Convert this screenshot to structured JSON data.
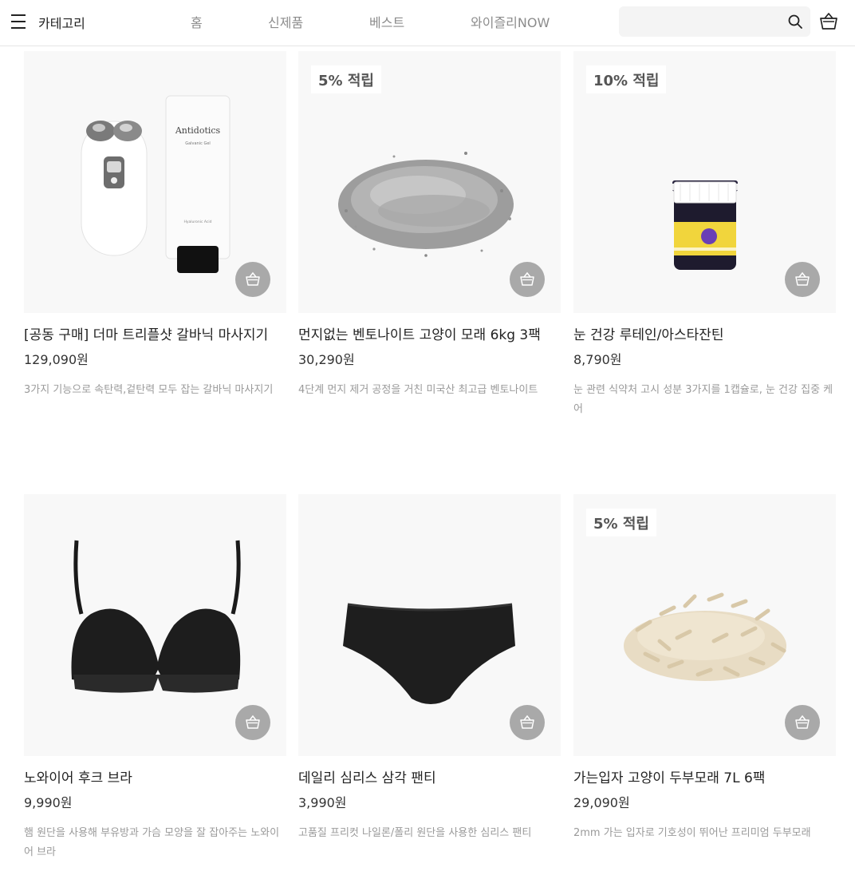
{
  "header": {
    "category_label": "카테고리",
    "nav": [
      "홈",
      "신제품",
      "베스트",
      "와이즐리NOW"
    ],
    "search_placeholder": ""
  },
  "products": [
    {
      "badge": "",
      "name": "[공동 구매] 더마 트리플샷 갈바닉 마사지기",
      "price": "129,090원",
      "desc": "3가지 기능으로 속탄력,겉탄력 모두 잡는 갈바닉 마사지기",
      "tube_brand": "Antidotics",
      "tube_sub": "Galvanic Gel",
      "tube_small": "Hyaluronic Acid"
    },
    {
      "badge": "5% 적립",
      "name": "먼지없는 벤토나이트 고양이 모래 6kg 3팩",
      "price": "30,290원",
      "desc": "4단계 먼지 제거 공정을 거친 미국산 최고급 벤토나이트"
    },
    {
      "badge": "10% 적립",
      "name": "눈 건강 루테인/아스타잔틴",
      "price": "8,790원",
      "desc": "눈 관련 식약처 고시 성분 3가지를 1캡슐로, 눈 건강 집중 케어"
    },
    {
      "badge": "",
      "name": "노와이어 후크 브라",
      "price": "9,990원",
      "desc": "햄 원단을 사용해 부유방과 가슴 모양을 잘 잡아주는 노와이어 브라"
    },
    {
      "badge": "",
      "name": "데일리 심리스 삼각 팬티",
      "price": "3,990원",
      "desc": "고품질 프리컷 나일론/폴리 원단을 사용한 심리스 팬티"
    },
    {
      "badge": "5% 적립",
      "name": "가는입자 고양이 두부모래 7L 6팩",
      "price": "29,090원",
      "desc": "2mm 가는 입자로 기호성이 뛰어난 프리미엄 두부모래"
    }
  ]
}
